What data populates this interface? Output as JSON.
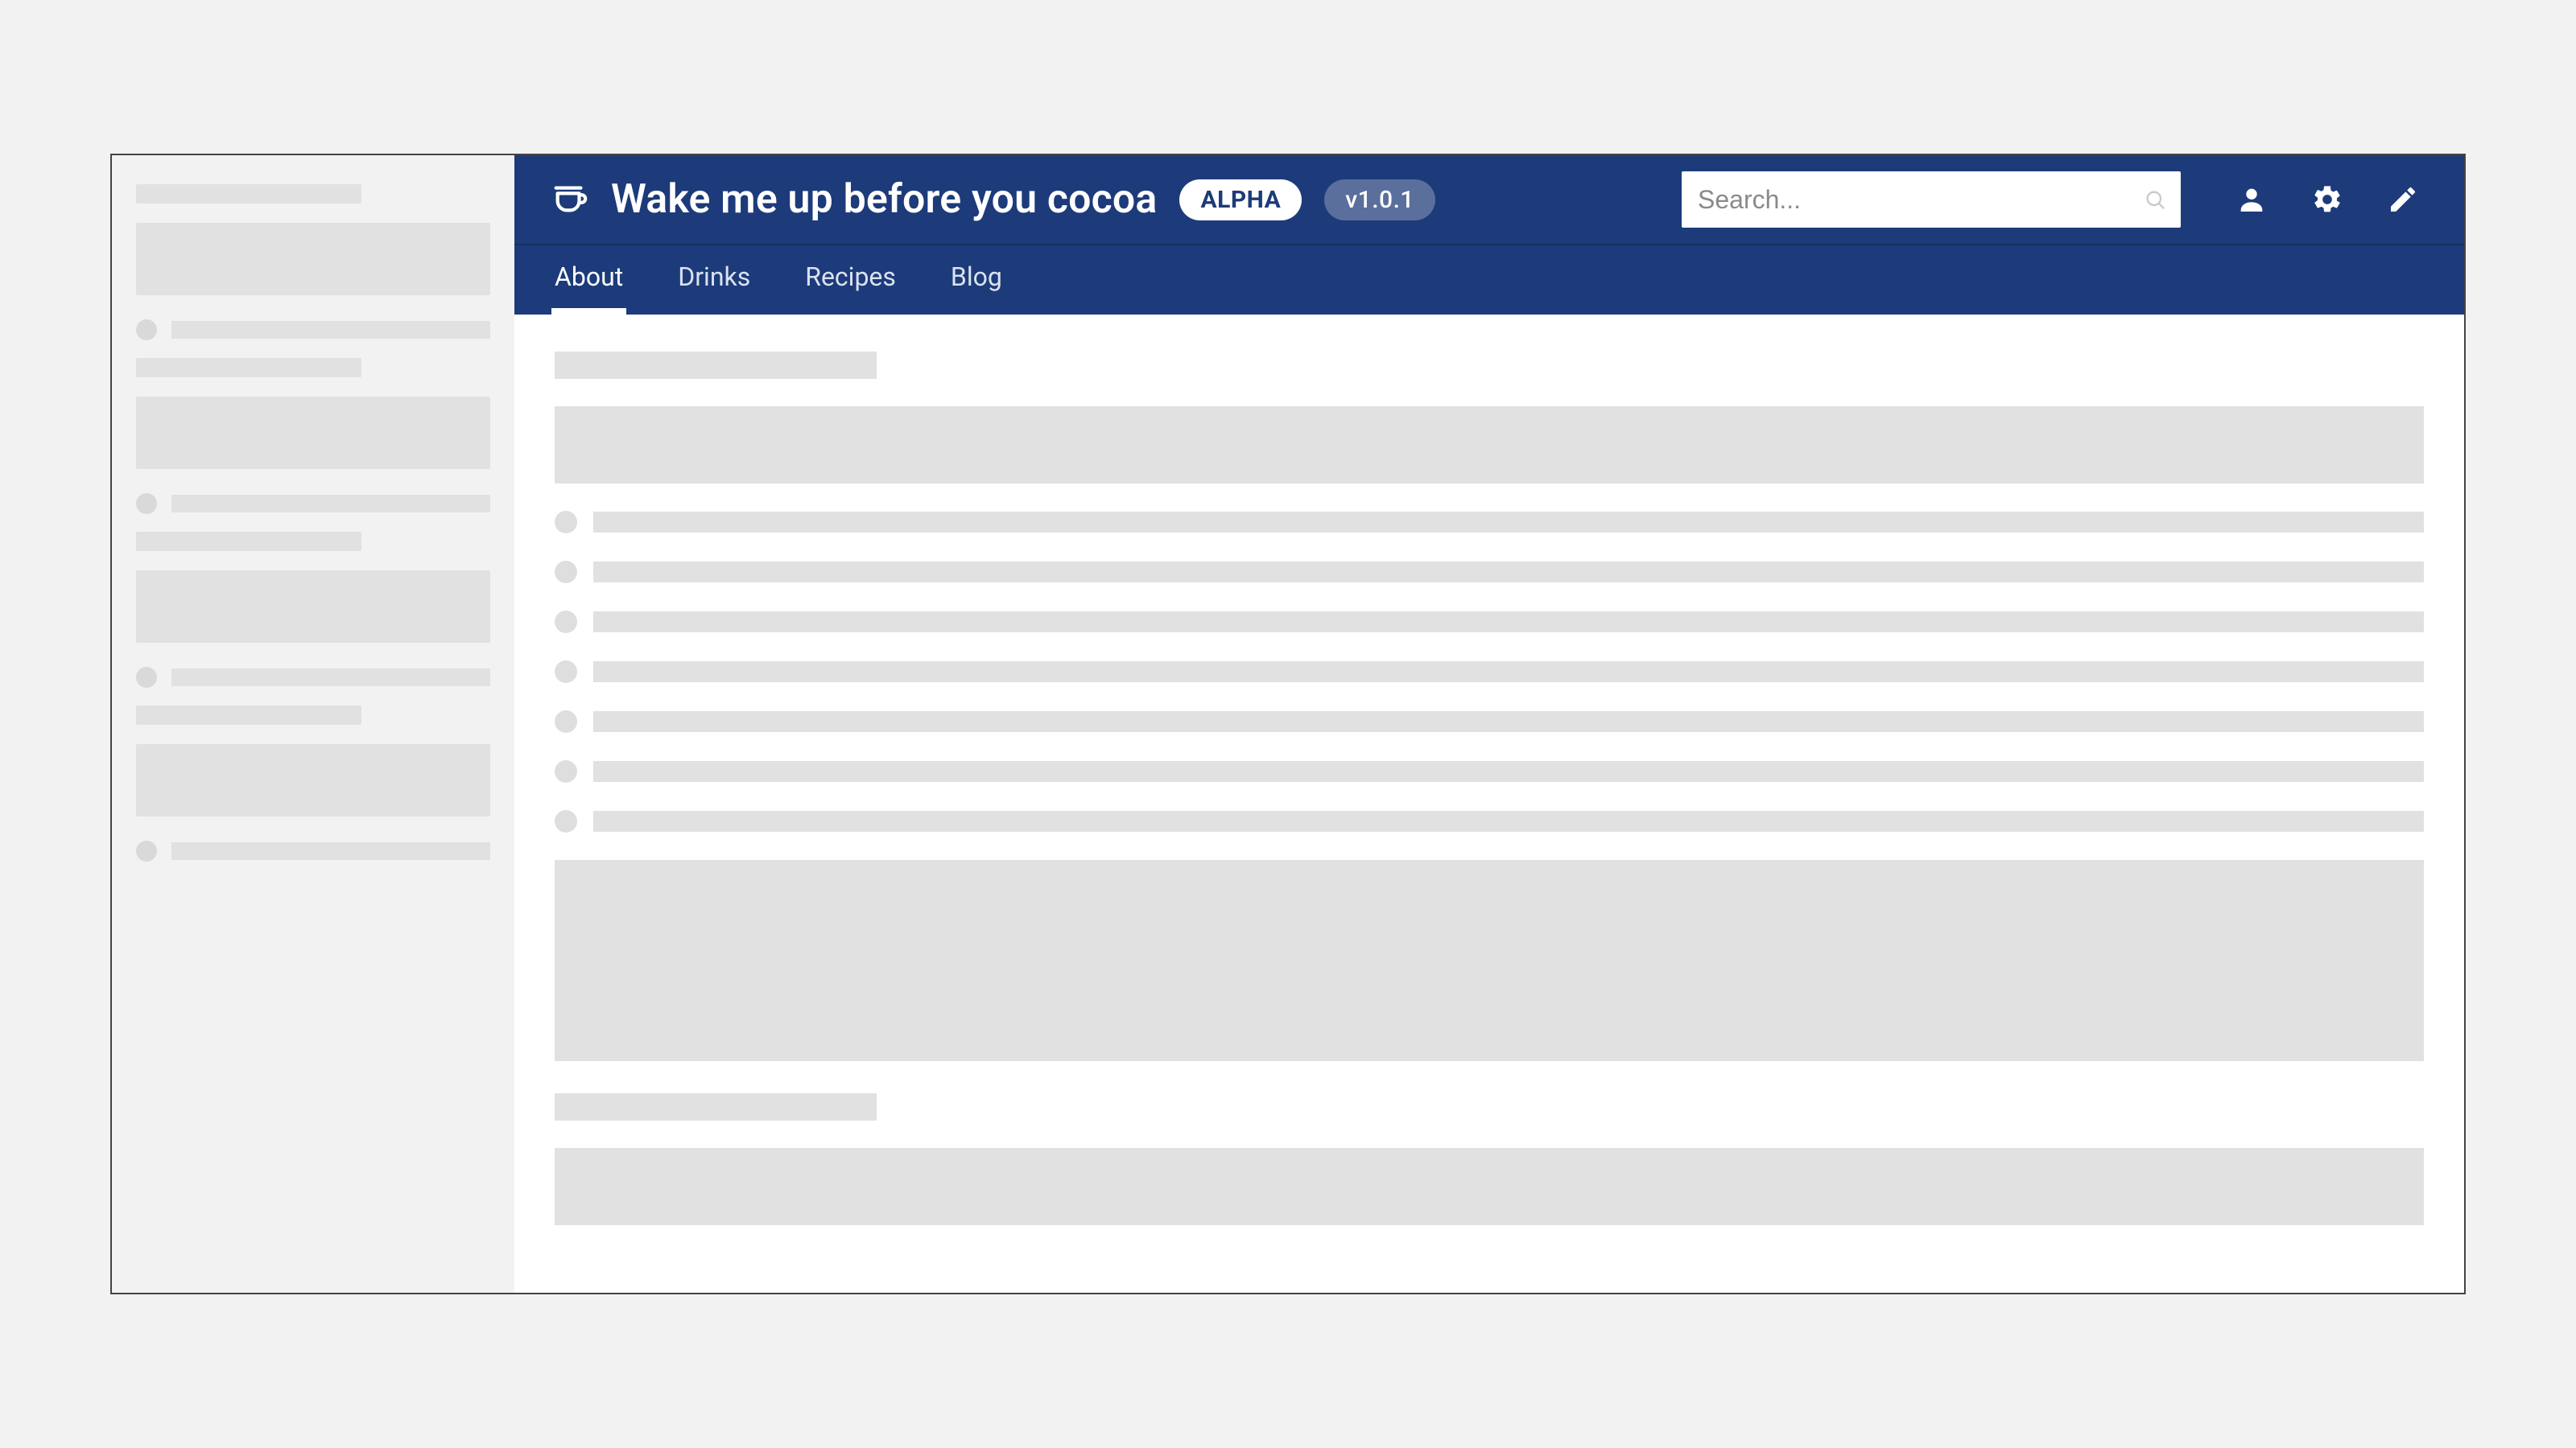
{
  "header": {
    "app_title": "Wake me up before you cocoa",
    "badge_alpha": "ALPHA",
    "badge_version": "v1.0.1",
    "search_placeholder": "Search..."
  },
  "tabs": {
    "items": [
      {
        "label": "About",
        "active": true
      },
      {
        "label": "Drinks",
        "active": false
      },
      {
        "label": "Recipes",
        "active": false
      },
      {
        "label": "Blog",
        "active": false
      }
    ]
  },
  "colors": {
    "header_bg": "#1d3b7a",
    "skeleton": "#e1e1e1",
    "sidebar_bg": "#f2f2f2"
  }
}
